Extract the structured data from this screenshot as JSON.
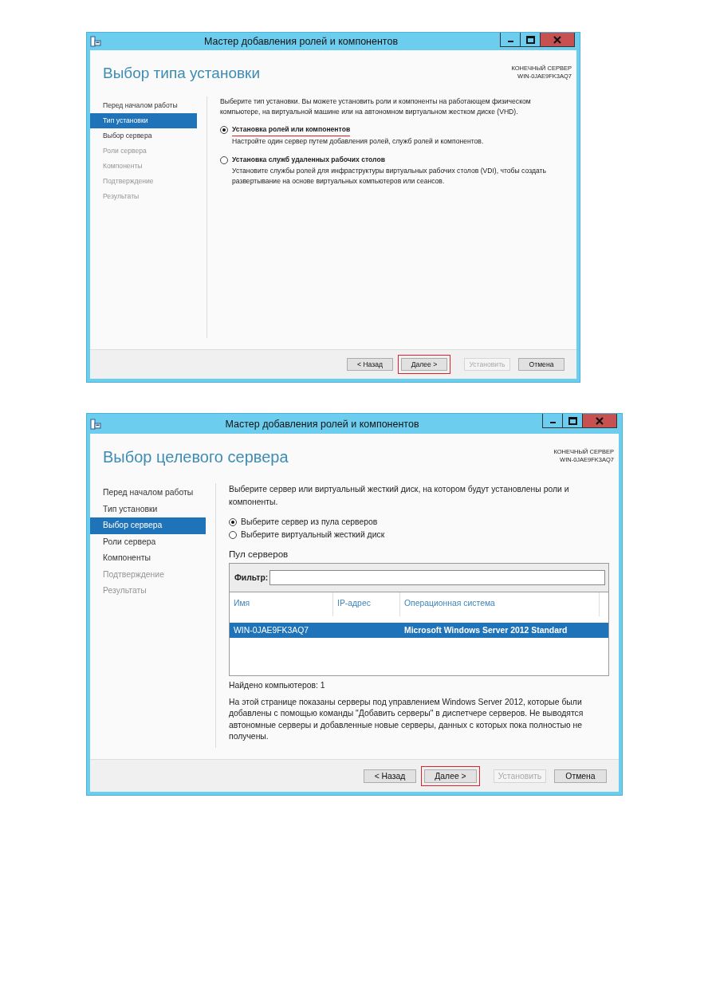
{
  "windows": [
    {
      "title": "Мастер добавления ролей и компонентов",
      "heading": "Выбор типа установки",
      "target_label": "КОНЕЧНЫЙ СЕРВЕР",
      "target_server": "WIN-0JAE9FK3AQ7",
      "steps": [
        {
          "label": "Перед началом работы",
          "selected": false,
          "disabled": false
        },
        {
          "label": "Тип установки",
          "selected": true,
          "disabled": false
        },
        {
          "label": "Выбор сервера",
          "selected": false,
          "disabled": false
        },
        {
          "label": "Роли сервера",
          "selected": false,
          "disabled": true
        },
        {
          "label": "Компоненты",
          "selected": false,
          "disabled": true
        },
        {
          "label": "Подтверждение",
          "selected": false,
          "disabled": true
        },
        {
          "label": "Результаты",
          "selected": false,
          "disabled": true
        }
      ],
      "intro": "Выберите тип установки. Вы можете установить роли и компоненты на работающем физическом компьютере, на виртуальной машине или на автономном виртуальном жестком диске (VHD).",
      "options": [
        {
          "label": "Установка ролей или компонентов",
          "description": "Настройте один сервер путем добавления ролей, служб ролей и компонентов.",
          "selected": true,
          "underlined": true
        },
        {
          "label": "Установка служб удаленных рабочих столов",
          "description": "Установите службы ролей для инфраструктуры виртуальных рабочих столов (VDI), чтобы создать развертывание на основе виртуальных компьютеров или сеансов.",
          "selected": false,
          "underlined": false
        }
      ],
      "buttons": [
        {
          "label": "< Назад",
          "disabled": false,
          "highlighted": false
        },
        {
          "label": "Далее >",
          "disabled": false,
          "highlighted": true
        },
        {
          "label": "Установить",
          "disabled": true,
          "highlighted": false
        },
        {
          "label": "Отмена",
          "disabled": false,
          "highlighted": false
        }
      ]
    },
    {
      "title": "Мастер добавления ролей и компонентов",
      "heading": "Выбор целевого сервера",
      "target_label": "КОНЕЧНЫЙ СЕРВЕР",
      "target_server": "WIN-0JAE9FK3AQ7",
      "steps": [
        {
          "label": "Перед началом работы",
          "selected": false,
          "disabled": false
        },
        {
          "label": "Тип установки",
          "selected": false,
          "disabled": false
        },
        {
          "label": "Выбор сервера",
          "selected": true,
          "disabled": false
        },
        {
          "label": "Роли сервера",
          "selected": false,
          "disabled": false
        },
        {
          "label": "Компоненты",
          "selected": false,
          "disabled": false
        },
        {
          "label": "Подтверждение",
          "selected": false,
          "disabled": true
        },
        {
          "label": "Результаты",
          "selected": false,
          "disabled": true
        }
      ],
      "intro": "Выберите сервер или виртуальный жесткий диск, на котором будут установлены роли и компоненты.",
      "options": [
        {
          "label": "Выберите сервер из пула серверов",
          "selected": true,
          "underlined": false
        },
        {
          "label": "Выберите виртуальный жесткий диск",
          "selected": false,
          "underlined": false
        }
      ],
      "server_pool": {
        "heading": "Пул серверов",
        "filter_label": "Фильтр:",
        "columns": [
          "Имя",
          "IP-адрес",
          "Операционная система"
        ],
        "rows": [
          {
            "name": "WIN-0JAE9FK3AQ7",
            "os": "Microsoft Windows Server 2012 Standard",
            "selected": true
          }
        ],
        "found": "Найдено компьютеров: 1",
        "note": "На этой странице показаны серверы под управлением Windows Server 2012, которые были добавлены с помощью команды \"Добавить серверы\" в диспетчере серверов. Не выводятся автономные серверы и добавленные новые серверы, данных с которых пока полностью не получены."
      },
      "buttons": [
        {
          "label": "< Назад",
          "disabled": false,
          "highlighted": false
        },
        {
          "label": "Далее >",
          "disabled": false,
          "highlighted": true
        },
        {
          "label": "Установить",
          "disabled": true,
          "highlighted": false
        },
        {
          "label": "Отмена",
          "disabled": false,
          "highlighted": false
        }
      ]
    }
  ]
}
